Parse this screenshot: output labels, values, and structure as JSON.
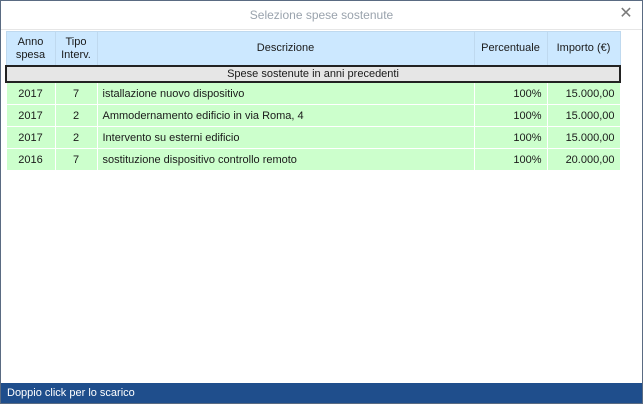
{
  "window": {
    "title": "Selezione spese sostenute",
    "close_symbol": "✕"
  },
  "table": {
    "headers": {
      "anno": [
        "Anno",
        "spesa"
      ],
      "tipo": [
        "Tipo",
        "Interv."
      ],
      "descrizione": "Descrizione",
      "percentuale": "Percentuale",
      "importo": "Importo (€)"
    },
    "group_label": "Spese sostenute in anni precedenti",
    "rows": [
      {
        "anno": "2017",
        "tipo": "7",
        "descrizione": "istallazione nuovo dispositivo",
        "percentuale": "100%",
        "importo": "15.000,00"
      },
      {
        "anno": "2017",
        "tipo": "2",
        "descrizione": "Ammodernamento edificio in via Roma, 4",
        "percentuale": "100%",
        "importo": "15.000,00"
      },
      {
        "anno": "2017",
        "tipo": "2",
        "descrizione": "Intervento su esterni edificio",
        "percentuale": "100%",
        "importo": "15.000,00"
      },
      {
        "anno": "2016",
        "tipo": "7",
        "descrizione": "sostituzione dispositivo controllo remoto",
        "percentuale": "100%",
        "importo": "20.000,00"
      }
    ]
  },
  "status": {
    "text": "Doppio click per lo scarico"
  },
  "colors": {
    "header_bg": "#cce8ff",
    "row_bg": "#ccffcc",
    "status_bg": "#1f4e8c"
  }
}
